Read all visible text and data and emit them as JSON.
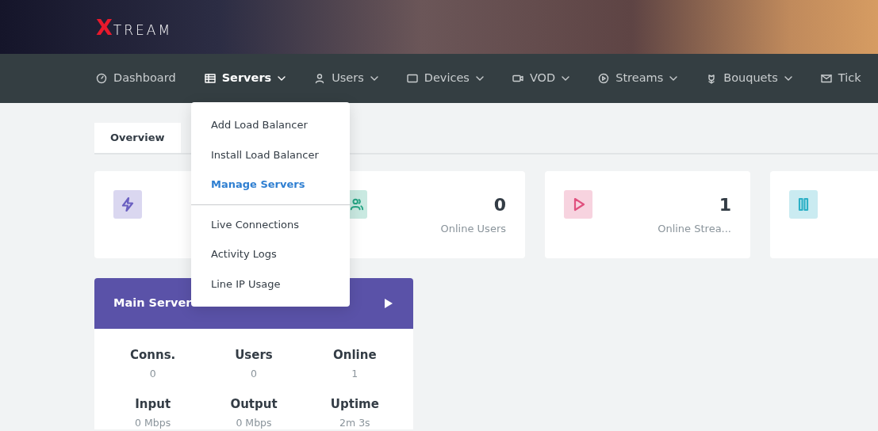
{
  "logo": "XTREAM",
  "nav": [
    {
      "label": "Dashboard",
      "selected": false,
      "dropdown": false
    },
    {
      "label": "Servers",
      "selected": true,
      "dropdown": true
    },
    {
      "label": "Users",
      "selected": false,
      "dropdown": true
    },
    {
      "label": "Devices",
      "selected": false,
      "dropdown": true
    },
    {
      "label": "VOD",
      "selected": false,
      "dropdown": true
    },
    {
      "label": "Streams",
      "selected": false,
      "dropdown": true
    },
    {
      "label": "Bouquets",
      "selected": false,
      "dropdown": true
    },
    {
      "label": "Tick",
      "selected": false,
      "dropdown": false
    }
  ],
  "dropdown_menu": {
    "groups": [
      [
        {
          "label": "Add Load Balancer",
          "selected": false
        },
        {
          "label": "Install Load Balancer",
          "selected": false
        },
        {
          "label": "Manage Servers",
          "selected": true
        }
      ],
      [
        {
          "label": "Live Connections",
          "selected": false
        },
        {
          "label": "Activity Logs",
          "selected": false
        },
        {
          "label": "Line IP Usage",
          "selected": false
        }
      ]
    ]
  },
  "tabs": [
    {
      "label": "Overview",
      "selected": true
    }
  ],
  "stat_cards": [
    {
      "color": "#6a5fc1"
    },
    {
      "color": "#27a585",
      "value": "0",
      "label": "Online Users"
    },
    {
      "color": "#e0507e",
      "value": "1",
      "label": "Online Strea..."
    },
    {
      "color": "#2cb0c6"
    }
  ],
  "server_card": {
    "title": "Main Server",
    "stats": [
      {
        "label": "Conns.",
        "value": "0"
      },
      {
        "label": "Users",
        "value": "0"
      },
      {
        "label": "Online",
        "value": "1"
      },
      {
        "label": "Input",
        "value": "0 Mbps"
      },
      {
        "label": "Output",
        "value": "0 Mbps"
      },
      {
        "label": "Uptime",
        "value": "2m 3s"
      }
    ]
  }
}
